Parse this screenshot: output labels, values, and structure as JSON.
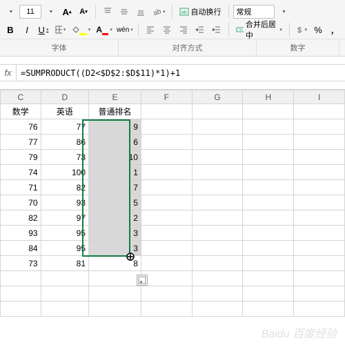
{
  "ribbon": {
    "font_size": "11",
    "increase_font": "A",
    "decrease_font": "A",
    "bold": "B",
    "italic": "I",
    "underline": "U",
    "wen": "wén",
    "wrap_text": "自动换行",
    "merge_center": "合并后居中",
    "number_format": "常规",
    "percent": "%",
    "comma": "，",
    "group_font": "字体",
    "group_align": "对齐方式",
    "group_number": "数字"
  },
  "formula": {
    "fx": "fx",
    "value": "=SUMPRODUCT((D2<$D$2:$D$11)*1)+1"
  },
  "columns": [
    "C",
    "D",
    "E",
    "F",
    "G",
    "H",
    "I"
  ],
  "headers": {
    "c": "数学",
    "d": "英语",
    "e": "普通排名"
  },
  "rows": [
    {
      "c": "76",
      "d": "77",
      "e": "9"
    },
    {
      "c": "77",
      "d": "86",
      "e": "6"
    },
    {
      "c": "79",
      "d": "73",
      "e": "10"
    },
    {
      "c": "74",
      "d": "100",
      "e": "1"
    },
    {
      "c": "71",
      "d": "82",
      "e": "7"
    },
    {
      "c": "70",
      "d": "93",
      "e": "5"
    },
    {
      "c": "82",
      "d": "97",
      "e": "2"
    },
    {
      "c": "93",
      "d": "95",
      "e": "3"
    },
    {
      "c": "84",
      "d": "95",
      "e": "3"
    },
    {
      "c": "73",
      "d": "81",
      "e": "8"
    }
  ],
  "watermark": "Baidu 百度经验"
}
